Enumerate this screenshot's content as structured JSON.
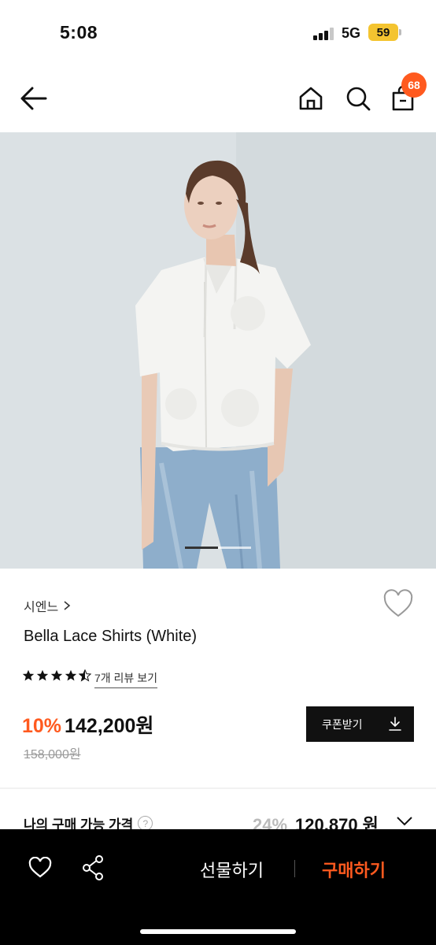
{
  "status_bar": {
    "time": "5:08",
    "network": "5G",
    "battery": "59"
  },
  "nav": {
    "cart_badge": "68"
  },
  "gallery": {
    "slide_count": 2,
    "current_slide": 1
  },
  "product": {
    "brand": "시엔느",
    "title": "Bella Lace Shirts (White)",
    "rating": 4.5,
    "review_link": "7개 리뷰 보기",
    "discount": "10%",
    "price": "142,200원",
    "original_price": "158,000원",
    "coupon_label": "쿠폰받기"
  },
  "my_price": {
    "label": "나의 구매 가능 가격",
    "help": "?",
    "discount": "24%",
    "amount": "120,870 원"
  },
  "bottom_bar": {
    "gift_label": "선물하기",
    "buy_label": "구매하기"
  },
  "colors": {
    "accent": "#ff5a1f",
    "dark": "#111111"
  }
}
